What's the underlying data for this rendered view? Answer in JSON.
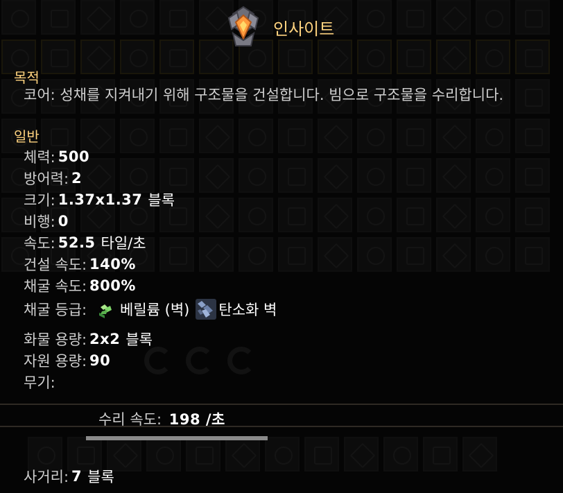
{
  "unit": {
    "name": "인사이트",
    "icon": "insight-core-unit-icon"
  },
  "sections": {
    "purpose": "목적",
    "general": "일반"
  },
  "description": "코어: 성채를 지켜내기 위해 구조물을 건설합니다. 빔으로 구조물을 수리합니다.",
  "stats": {
    "health": {
      "label": "체력:",
      "value": "500"
    },
    "armor": {
      "label": "방어력:",
      "value": "2"
    },
    "size": {
      "label": "크기:",
      "value": "1.37x1.37",
      "unit": "블록"
    },
    "flying": {
      "label": "비행:",
      "value": "0"
    },
    "speed": {
      "label": "속도:",
      "value": "52.5",
      "unit": "타일/초"
    },
    "build_speed": {
      "label": "건설 속도:",
      "value": "140%"
    },
    "mine_speed": {
      "label": "채굴 속도:",
      "value": "800%"
    },
    "mine_tier": {
      "label": "채굴 등급:",
      "items": [
        {
          "icon": "beryllium-wall-icon",
          "name": "베릴륨 (벽)"
        },
        {
          "icon": "tungsten-carbide-wall-icon",
          "name": "탄소화 벽"
        }
      ]
    },
    "item_capacity": {
      "label": "화물 용량:",
      "value": "2x2",
      "unit": "블록"
    },
    "resource_capacity": {
      "label": "자원 용량:",
      "value": "90"
    },
    "weapons": {
      "label": "무기:"
    }
  },
  "weapon": {
    "repair_speed": {
      "label": "수리 속도:",
      "value": "198 /초"
    },
    "repair_bar_fraction": 1.0,
    "range": {
      "label": "사거리:",
      "value": "7",
      "unit": "블록"
    }
  },
  "colors": {
    "accent": "#ffd37f",
    "text": "#cfcfcf",
    "value": "#ffffff"
  }
}
